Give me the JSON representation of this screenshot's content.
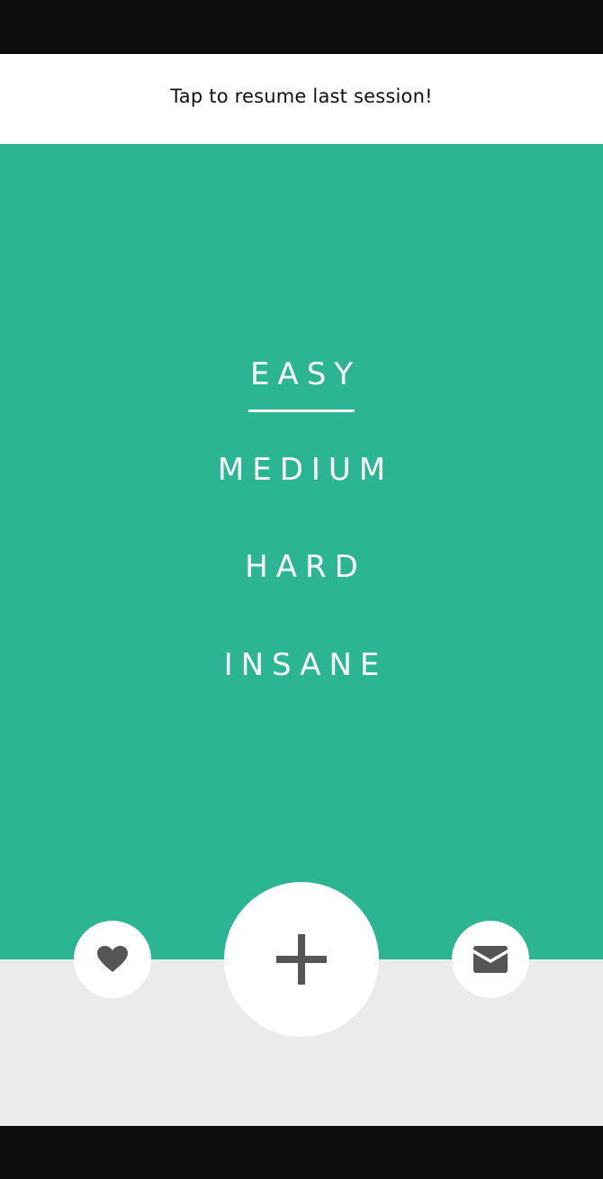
{
  "banner": {
    "resume_text": "Tap to resume last session!"
  },
  "difficulty": {
    "selected": "EASY",
    "items": [
      {
        "label": "EASY"
      },
      {
        "label": "MEDIUM"
      },
      {
        "label": "HARD"
      },
      {
        "label": "INSANE"
      }
    ]
  },
  "actions": {
    "favorite_icon": "heart-icon",
    "add_icon": "plus-icon",
    "mail_icon": "envelope-icon"
  },
  "colors": {
    "accent": "#2bb592",
    "bottom_background": "#ebebeb",
    "icon": "#555555",
    "system_bars": "#0c0c0c"
  }
}
